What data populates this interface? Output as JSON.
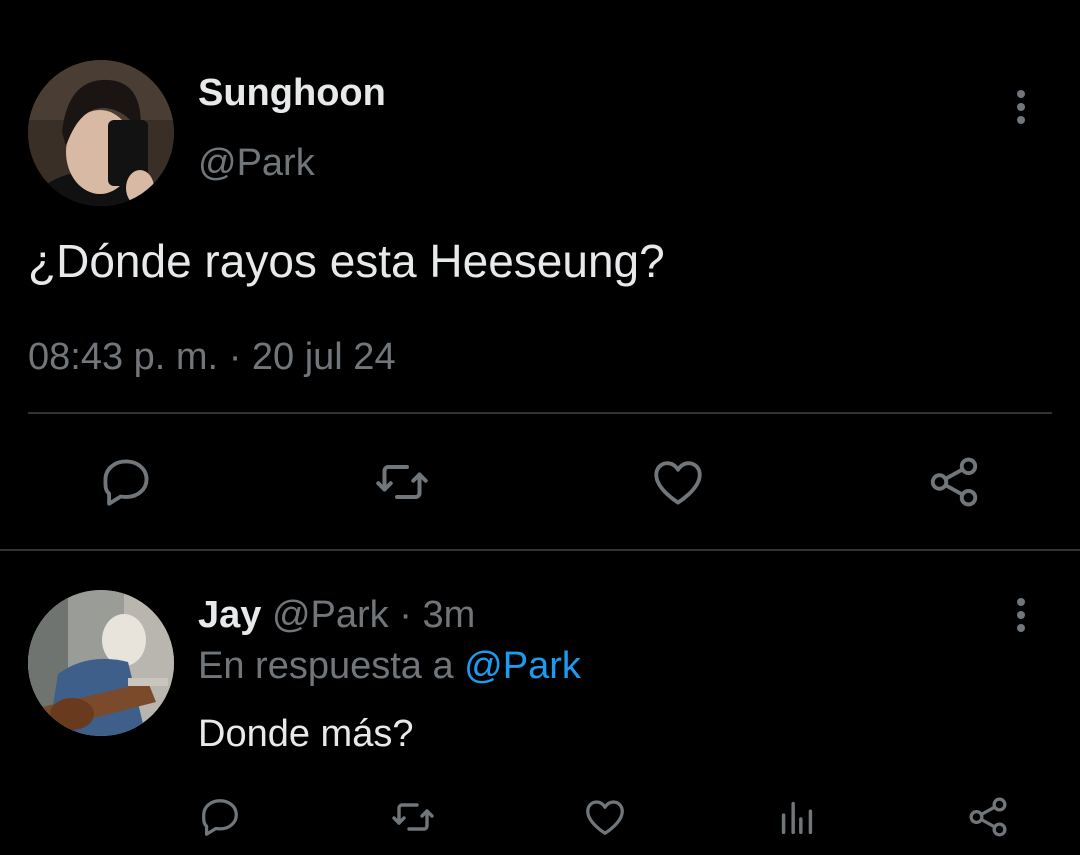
{
  "tweet": {
    "author_name": "Sunghoon",
    "author_handle": "@Park",
    "text": "¿Dónde rayos esta Heeseung?",
    "time": "08:43 p. m.",
    "separator": "·",
    "date": "20 jul 24",
    "more_icon": "more-vertical-icon",
    "actions": [
      {
        "name": "reply",
        "icon": "reply-icon"
      },
      {
        "name": "retweet",
        "icon": "retweet-icon"
      },
      {
        "name": "like",
        "icon": "heart-icon"
      },
      {
        "name": "share",
        "icon": "share-icon"
      }
    ]
  },
  "reply": {
    "author_name": "Jay",
    "author_handle": "@Park",
    "separator": "·",
    "time": "3m",
    "context_prefix": "En respuesta a",
    "context_mention": "@Park",
    "text": "Donde más?",
    "more_icon": "more-vertical-icon",
    "actions": [
      {
        "name": "reply",
        "icon": "reply-icon"
      },
      {
        "name": "retweet",
        "icon": "retweet-icon"
      },
      {
        "name": "like",
        "icon": "heart-icon"
      },
      {
        "name": "analytics",
        "icon": "bar-chart-icon"
      },
      {
        "name": "share",
        "icon": "share-icon"
      }
    ]
  },
  "colors": {
    "background": "#000000",
    "primary_text": "#e7e9ea",
    "secondary_text": "#71767b",
    "mention": "#1d9bf0",
    "divider": "#2f3336"
  }
}
